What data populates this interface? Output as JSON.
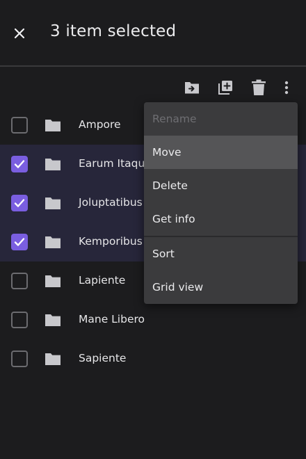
{
  "header": {
    "title": "3 item selected",
    "close_icon": "close-icon"
  },
  "toolbar": {
    "icons": [
      "move-to-folder-icon",
      "add-copy-icon",
      "trash-icon",
      "more-vert-icon"
    ]
  },
  "folders": [
    {
      "name": "Ampore",
      "selected": false
    },
    {
      "name": "Earum Itaque",
      "selected": true
    },
    {
      "name": "Joluptatibus",
      "selected": true
    },
    {
      "name": "Kemporibus",
      "selected": true
    },
    {
      "name": "Lapiente",
      "selected": false
    },
    {
      "name": "Mane Libero",
      "selected": false
    },
    {
      "name": "Sapiente",
      "selected": false
    }
  ],
  "menu": {
    "items": [
      {
        "label": "Rename",
        "state": "disabled"
      },
      {
        "label": "Move",
        "state": "active"
      },
      {
        "label": "Delete",
        "state": "normal"
      },
      {
        "label": "Get info",
        "state": "normal"
      },
      {
        "label": "Sort",
        "state": "normal"
      },
      {
        "label": "Grid view",
        "state": "normal"
      }
    ]
  },
  "colors": {
    "background": "#1c1c1e",
    "accent": "#7a5ee0",
    "selected_row": "#27263a",
    "menu_bg": "#3b3b3d",
    "menu_active": "#555557",
    "icon": "#c8c8cc"
  }
}
